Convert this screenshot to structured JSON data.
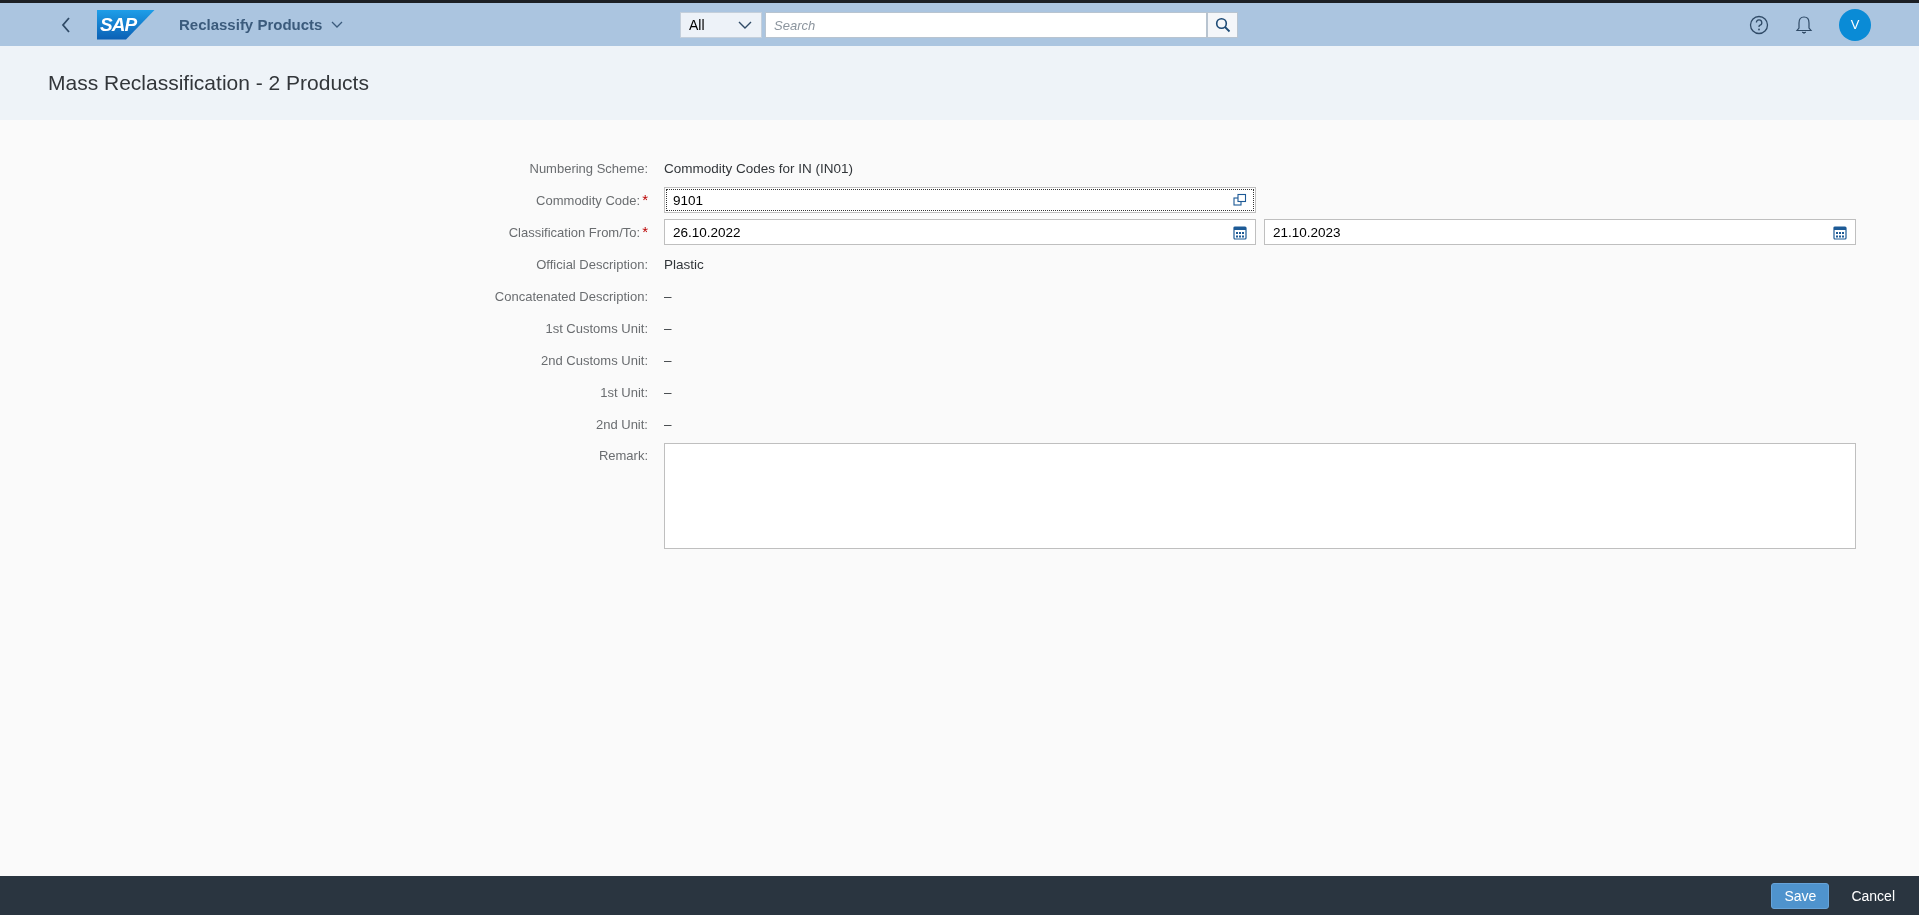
{
  "shell": {
    "logo": "SAP",
    "app_title": "Reclassify Products",
    "search": {
      "scope": "All",
      "placeholder": "Search"
    },
    "avatar": "V"
  },
  "page_title": "Mass Reclassification - 2 Products",
  "form": [
    {
      "kind": "text",
      "label": "Numbering Scheme:",
      "value": "Commodity Codes for IN (IN01)"
    },
    {
      "kind": "input",
      "label": "Commodity Code:",
      "required_mark": "*",
      "value": "9101",
      "focused": true
    },
    {
      "kind": "daterange",
      "label": "Classification From/To:",
      "required_mark": "*",
      "from": "26.10.2022",
      "to": "21.10.2023"
    },
    {
      "kind": "text",
      "label": "Official Description:",
      "value": "Plastic"
    },
    {
      "kind": "text",
      "label": "Concatenated Description:",
      "value": "–"
    },
    {
      "kind": "text",
      "label": "1st Customs Unit:",
      "value": "–"
    },
    {
      "kind": "text",
      "label": "2nd Customs Unit:",
      "value": "–"
    },
    {
      "kind": "text",
      "label": "1st Unit:",
      "value": "–"
    },
    {
      "kind": "text",
      "label": "2nd Unit:",
      "value": "–"
    },
    {
      "kind": "textarea",
      "label": "Remark:"
    }
  ],
  "footer": {
    "buttons": [
      {
        "label": "Save",
        "kind": "primary"
      },
      {
        "label": "Cancel",
        "kind": "transparent"
      }
    ]
  }
}
